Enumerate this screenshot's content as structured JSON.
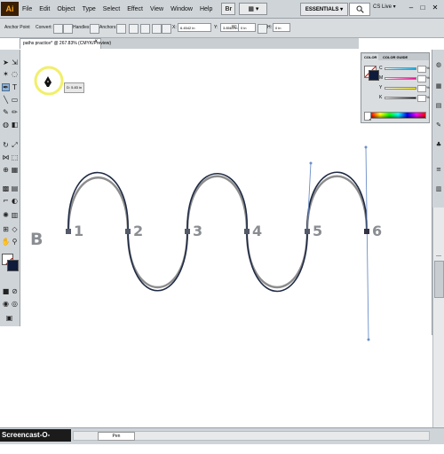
{
  "app": {
    "logo_text": "Ai",
    "menu_items": [
      "File",
      "Edit",
      "Object",
      "Type",
      "Select",
      "Effect",
      "View",
      "Window",
      "Help"
    ],
    "bridge_label": "Br",
    "arrange_label": "▦ ▾",
    "workspace": "ESSENTIALS ▾",
    "search_icon": "search-icon",
    "cs_live": "CS Live ▾",
    "window_controls": [
      "–",
      "□",
      "✕"
    ]
  },
  "control_bar": {
    "anchor_point_label": "Anchor Point",
    "convert_label": "Convert:",
    "handles_label": "Handles:",
    "anchors_label": "Anchors:",
    "x_label": "X:",
    "x_value": "6.4542 in",
    "y_label": "Y:",
    "y_value": "3.8581 in",
    "w_label": "W:",
    "w_value": "0 in",
    "h_label": "H:",
    "h_value": "0 in"
  },
  "document": {
    "tab_title": "paths practice* @ 267.83% (CMYK/Preview)",
    "close_glyph": "×"
  },
  "canvas": {
    "letter": "B",
    "anchor_labels": [
      "1",
      "2",
      "3",
      "4",
      "5",
      "6"
    ],
    "tooltip": "D: 5.83 in",
    "path_stroke_color": "#1f2a44",
    "template_stroke_color": "#8c8c8c",
    "highlight_color": "#f1ef6a"
  },
  "color_panel": {
    "tabs": [
      "COLOR",
      "COLOR GUIDE"
    ],
    "channels": [
      {
        "label": "C",
        "unit": "%"
      },
      {
        "label": "M",
        "unit": "%"
      },
      {
        "label": "Y",
        "unit": "%"
      },
      {
        "label": "K",
        "unit": "%"
      }
    ]
  },
  "status": {
    "tool_mode": "Pen",
    "watermark": "Screencast-O-Matic.com"
  }
}
